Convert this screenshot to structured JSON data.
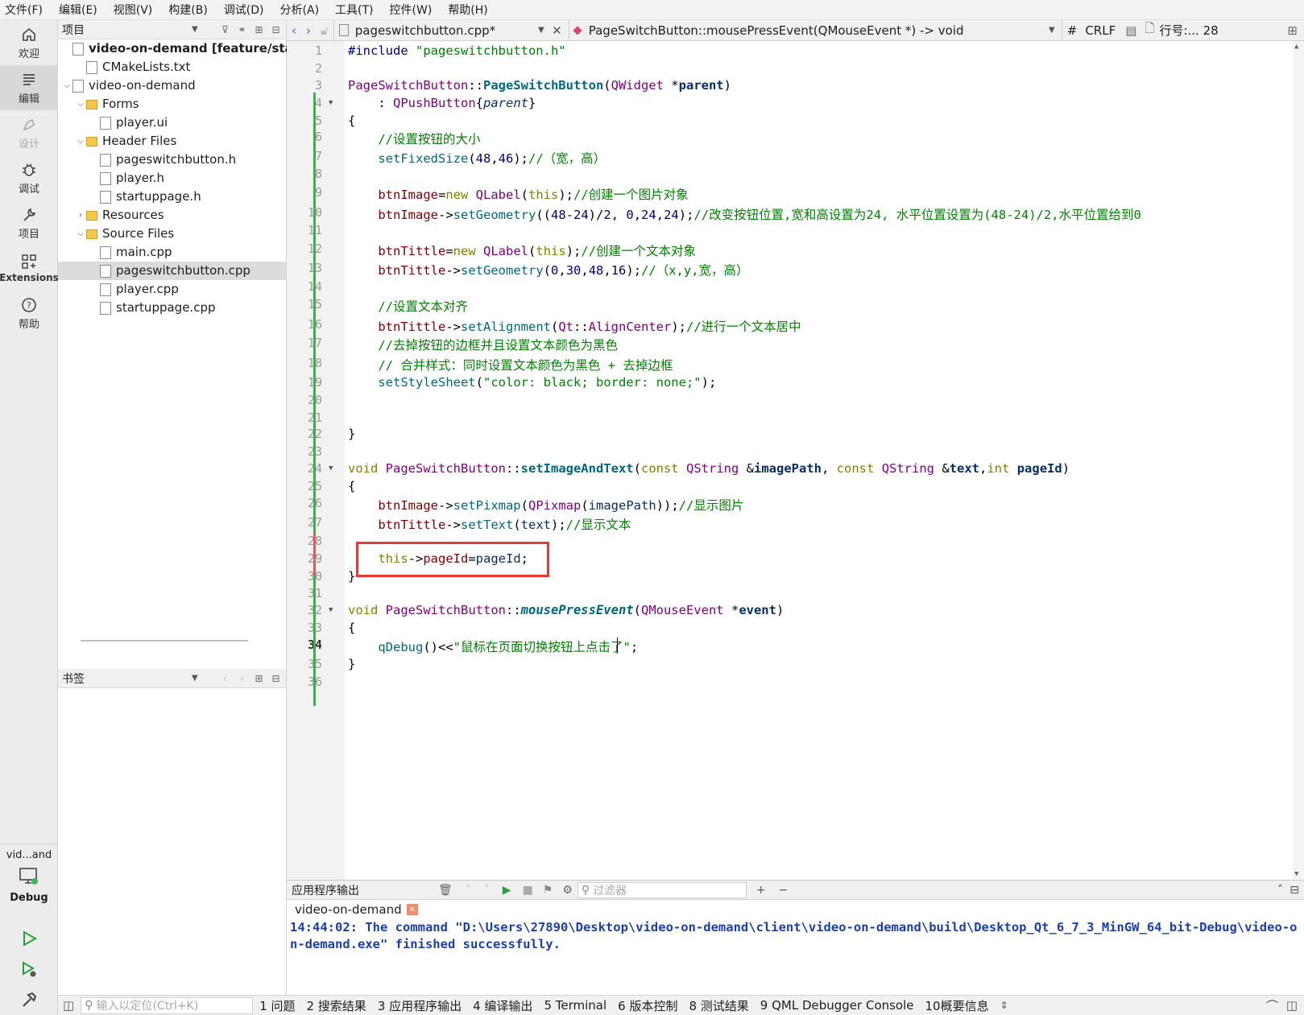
{
  "menu": [
    "文件(F)",
    "编辑(E)",
    "视图(V)",
    "构建(B)",
    "调试(D)",
    "分析(A)",
    "工具(T)",
    "控件(W)",
    "帮助(H)"
  ],
  "modes": [
    {
      "label": "欢迎",
      "icon": "home-icon"
    },
    {
      "label": "编辑",
      "icon": "edit-icon"
    },
    {
      "label": "设计",
      "icon": "design-icon"
    },
    {
      "label": "调试",
      "icon": "debug-icon"
    },
    {
      "label": "项目",
      "icon": "wrench-icon"
    },
    {
      "label": "Extensions",
      "icon": "extensions-icon"
    },
    {
      "label": "帮助",
      "icon": "help-icon"
    }
  ],
  "kit": {
    "project": "vid...and",
    "mode": "Debug"
  },
  "project_pane": {
    "title": "项目",
    "tree": [
      {
        "label": "video-on-demand [feature/startui",
        "depth": 0,
        "bold": true
      },
      {
        "label": "CMakeLists.txt",
        "depth": 1
      },
      {
        "label": "video-on-demand",
        "depth": 0,
        "arrow": "v"
      },
      {
        "label": "Forms",
        "depth": 1,
        "arrow": "v",
        "folder": true
      },
      {
        "label": "player.ui",
        "depth": 2
      },
      {
        "label": "Header Files",
        "depth": 1,
        "arrow": "v",
        "folder": true
      },
      {
        "label": "pageswitchbutton.h",
        "depth": 2
      },
      {
        "label": "player.h",
        "depth": 2
      },
      {
        "label": "startuppage.h",
        "depth": 2
      },
      {
        "label": "Resources",
        "depth": 1,
        "arrow": ">",
        "folder": true
      },
      {
        "label": "Source Files",
        "depth": 1,
        "arrow": "v",
        "folder": true
      },
      {
        "label": "main.cpp",
        "depth": 2
      },
      {
        "label": "pageswitchbutton.cpp",
        "depth": 2,
        "selected": true
      },
      {
        "label": "player.cpp",
        "depth": 2
      },
      {
        "label": "startuppage.cpp",
        "depth": 2
      }
    ]
  },
  "bookmarks": {
    "title": "书签"
  },
  "editor_header": {
    "file": "pageswitchbutton.cpp*",
    "symbol": "PageSwitchButton::mousePressEvent(QMouseEvent *) -> void",
    "line_ending": "CRLF",
    "position": "行号:... 28"
  },
  "code": {
    "line_numbers": [
      "1",
      "2",
      "3",
      "4",
      "5",
      "6",
      "7",
      "8",
      "9",
      "10",
      "11",
      "12",
      "13",
      "14",
      "15",
      "16",
      "17",
      "18",
      "19",
      "20",
      "21",
      "22",
      "23",
      "24",
      "25",
      "26",
      "27",
      "28",
      "29",
      "30",
      "31",
      "32",
      "33",
      "34",
      "35",
      "36"
    ],
    "current_line": "34"
  },
  "output": {
    "title": "应用程序输出",
    "filter_placeholder": "过滤器",
    "tab": "video-on-demand",
    "text": "14:44:02: The command \"D:\\Users\\27890\\Desktop\\video-on-demand\\client\\video-on-demand\\build\\Desktop_Qt_6_7_3_MinGW_64_bit-Debug\\video-on-demand.exe\" finished successfully."
  },
  "status": {
    "locator_placeholder": "输入以定位(Ctrl+K)",
    "tabs": [
      "1 问题",
      "2 搜索结果",
      "3 应用程序输出",
      "4 编译输出",
      "5 Terminal",
      "6 版本控制",
      "8 测试结果",
      "9 QML Debugger Console",
      "10概要信息"
    ]
  },
  "colors": {
    "highlight_box": "#e53935",
    "keyword": "#808000",
    "type": "#800080",
    "comment": "#008000"
  }
}
